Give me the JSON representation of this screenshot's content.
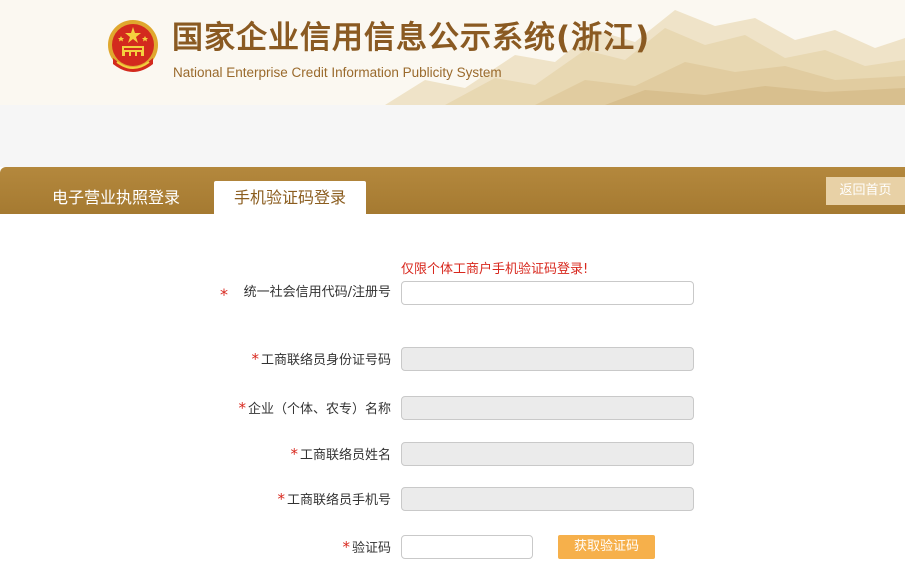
{
  "header": {
    "title": "国家企业信用信息公示系统(浙江)",
    "subtitle": "National Enterprise Credit Information Publicity System"
  },
  "tabs": {
    "electronic_license_login": "电子营业执照登录",
    "sms_code_login": "手机验证码登录"
  },
  "home_button": "返回首页",
  "form": {
    "notice": "仅限个体工商户手机验证码登录!",
    "required_mark": "*",
    "fields": [
      {
        "label": "统一社会信用代码/注册号",
        "value": "",
        "disabled": false
      },
      {
        "label": "工商联络员身份证号码",
        "value": "",
        "disabled": true
      },
      {
        "label": "企业（个体、农专）名称",
        "value": "",
        "disabled": true
      },
      {
        "label": "工商联络员姓名",
        "value": "",
        "disabled": true
      },
      {
        "label": "工商联络员手机号",
        "value": "",
        "disabled": true
      },
      {
        "label": "验证码",
        "value": "",
        "disabled": false
      }
    ],
    "get_code_button": "获取验证码"
  },
  "colors": {
    "brand_gold": "#a97d33",
    "title_brown": "#8a5a22",
    "required_red": "#d8281e",
    "button_orange": "#f6b04b",
    "home_button_bg": "#e8d1a6"
  },
  "icons": {
    "emblem": "national-emblem-icon"
  }
}
